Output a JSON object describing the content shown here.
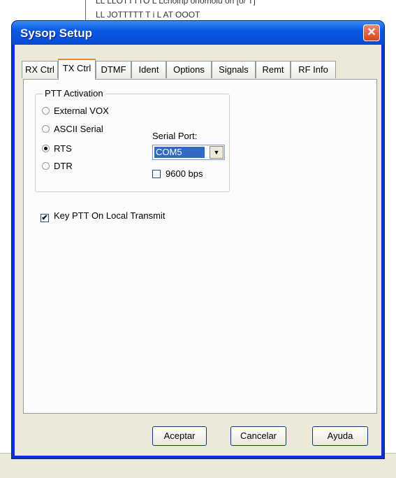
{
  "background": {
    "rows": [
      "LL LLOTTTTO L       Lchoinp onomoiu on [o/ T]",
      "LL JOTTTTT           T i       L      AT  OOOT"
    ]
  },
  "window": {
    "title": "Sysop Setup",
    "close_icon": "close-icon"
  },
  "tabs": [
    "RX Ctrl",
    "TX Ctrl",
    "DTMF",
    "Ident",
    "Options",
    "Signals",
    "Remt",
    "RF Info"
  ],
  "active_tab": "TX Ctrl",
  "ptt_activation": {
    "legend": "PTT Activation",
    "options": [
      {
        "label": "External VOX",
        "selected": false
      },
      {
        "label": "ASCII Serial",
        "selected": false
      },
      {
        "label": "RTS",
        "selected": true
      },
      {
        "label": "DTR",
        "selected": false
      }
    ],
    "serial_port_label": "Serial Port:",
    "serial_port_value": "COM5",
    "bps_label": "9600 bps",
    "bps_checked": false
  },
  "key_ptt": {
    "label": "Key PTT On Local Transmit",
    "checked": true,
    "mark": "✔"
  },
  "buttons": {
    "accept": "Aceptar",
    "cancel": "Cancelar",
    "help": "Ayuda"
  },
  "colors": {
    "title_bar": "#0758e3",
    "active_tab_accent": "#e68b2c",
    "selection": "#316ac5"
  }
}
